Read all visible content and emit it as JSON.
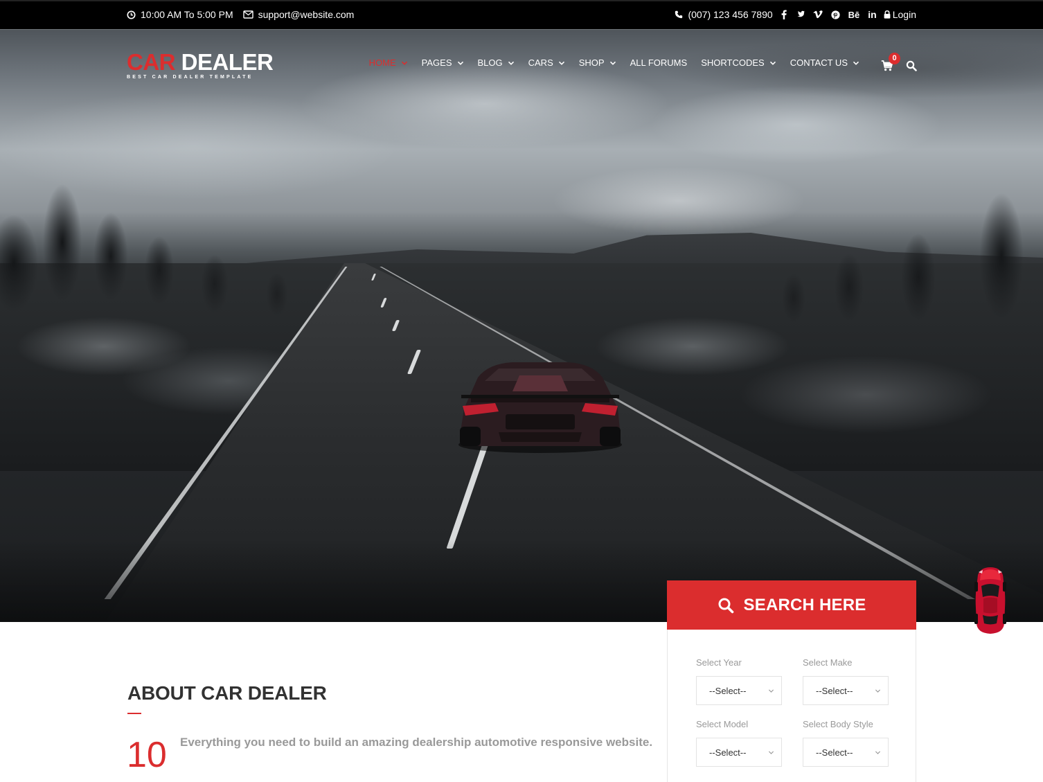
{
  "topbar": {
    "hours": "10:00 AM To 5:00 PM",
    "email": "support@website.com",
    "phone": "(007) 123 456 7890",
    "social": [
      "facebook-icon",
      "twitter-icon",
      "vimeo-icon",
      "pinterest-icon",
      "behance-icon",
      "linkedin-icon"
    ],
    "behance_label": "Bē",
    "linkedin_label": "in",
    "login": "Login"
  },
  "logo": {
    "word1": "CAR",
    "word2": "DEALER",
    "tagline": "BEST CAR DEALER TEMPLATE"
  },
  "nav": {
    "items": [
      {
        "label": "HOME",
        "active": true,
        "dropdown": true
      },
      {
        "label": "PAGES",
        "active": false,
        "dropdown": true
      },
      {
        "label": "BLOG",
        "active": false,
        "dropdown": true
      },
      {
        "label": "CARS",
        "active": false,
        "dropdown": true
      },
      {
        "label": "SHOP",
        "active": false,
        "dropdown": true
      },
      {
        "label": "ALL FORUMS",
        "active": false,
        "dropdown": false
      },
      {
        "label": "SHORTCODES",
        "active": false,
        "dropdown": true
      },
      {
        "label": "CONTACT US",
        "active": false,
        "dropdown": true
      }
    ],
    "cart_count": "0"
  },
  "search_panel": {
    "title": "SEARCH HERE",
    "fields": [
      {
        "label": "Select Year",
        "value": "--Select--"
      },
      {
        "label": "Select Make",
        "value": "--Select--"
      },
      {
        "label": "Select Model",
        "value": "--Select--"
      },
      {
        "label": "Select Body Style",
        "value": "--Select--"
      }
    ]
  },
  "about": {
    "title": "ABOUT CAR DEALER",
    "number": "10",
    "text": "Everything you need to build an amazing dealership automotive responsive website."
  },
  "colors": {
    "accent": "#db2d2e",
    "topbar_bg": "#000000",
    "muted_text": "#999999",
    "heading": "#323232"
  }
}
